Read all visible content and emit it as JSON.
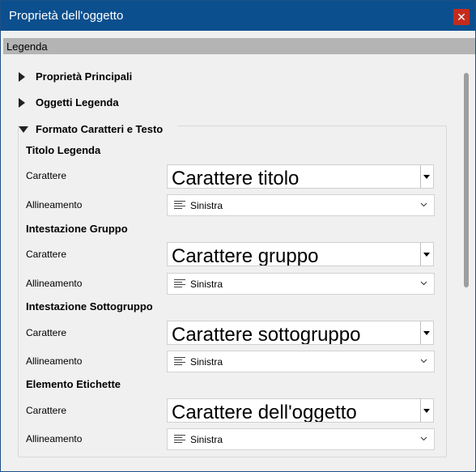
{
  "window": {
    "title": "Proprietà dell'oggetto",
    "close_glyph": "✕"
  },
  "header": {
    "label": "Legenda"
  },
  "sections": {
    "main": "Proprietà Principali",
    "legend_objects": "Oggetti Legenda",
    "format": "Formato Caratteri e Testo"
  },
  "groups": [
    {
      "title": "Titolo Legenda",
      "font_label": "Carattere",
      "font_value": "Carattere titolo",
      "align_label": "Allineamento",
      "align_value": "Sinistra"
    },
    {
      "title": "Intestazione Gruppo",
      "font_label": "Carattere",
      "font_value": "Carattere gruppo",
      "align_label": "Allineamento",
      "align_value": "Sinistra"
    },
    {
      "title": "Intestazione Sottogruppo",
      "font_label": "Carattere",
      "font_value": "Carattere sottogruppo",
      "align_label": "Allineamento",
      "align_value": "Sinistra"
    },
    {
      "title": "Elemento Etichette",
      "font_label": "Carattere",
      "font_value": "Carattere dell'oggetto",
      "align_label": "Allineamento",
      "align_value": "Sinistra"
    }
  ]
}
